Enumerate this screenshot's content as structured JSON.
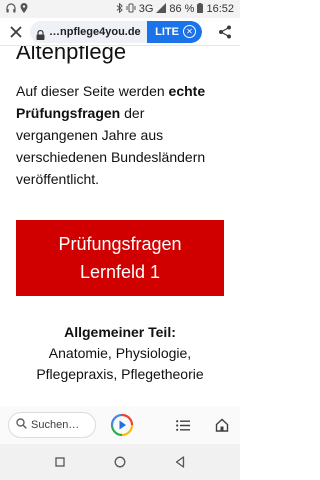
{
  "status_bar": {
    "network": "3G",
    "battery": "86 %",
    "time": "16:52"
  },
  "toolbar": {
    "url": "…npflege4you.de",
    "lite_label": "LITE"
  },
  "page": {
    "heading": "Altenpflege",
    "intro_part1": "Auf dieser Seite werden ",
    "intro_bold": "echte Prüfungsfragen",
    "intro_part2": " der vergangenen Jahre aus verschiedenen Bundesländern veröffentlicht.",
    "cta_line1": "Prüfungsfragen",
    "cta_line2": "Lernfeld 1",
    "section_title": "Allgemeiner Teil:",
    "section_items": "Anatomie, Physiologie, Pflegepraxis, Pflegetheorie"
  },
  "bottom_bar": {
    "search_placeholder": "Suchen…"
  },
  "colors": {
    "cta_red": "#d00000",
    "lite_blue": "#1a73e8"
  }
}
